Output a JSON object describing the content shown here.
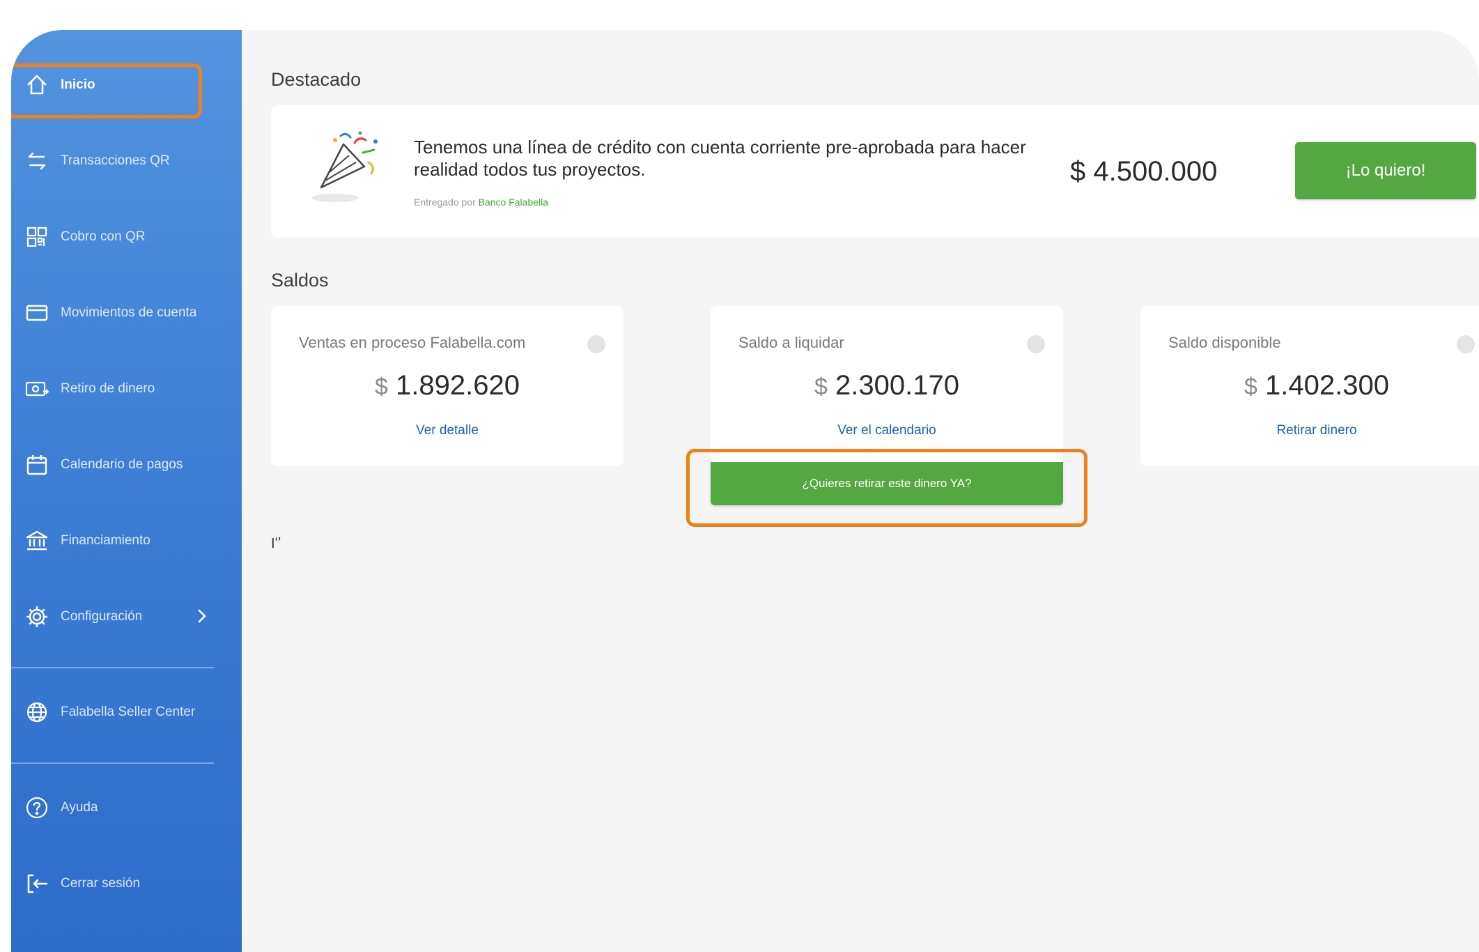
{
  "sidebar": {
    "items": [
      {
        "label": "Inicio",
        "icon": "home-icon"
      },
      {
        "label": "Transacciones QR",
        "icon": "transfer-arrows-icon"
      },
      {
        "label": "Cobro con QR",
        "icon": "qr-code-icon"
      },
      {
        "label": "Movimientos de cuenta",
        "icon": "card-icon"
      },
      {
        "label": "Retiro de dinero",
        "icon": "cash-withdraw-icon"
      },
      {
        "label": "Calendario de pagos",
        "icon": "calendar-icon"
      },
      {
        "label": "Financiamiento",
        "icon": "bank-icon"
      },
      {
        "label": "Configuración",
        "icon": "gear-icon"
      },
      {
        "label": "Falabella Seller Center",
        "icon": "globe-icon"
      },
      {
        "label": "Ayuda",
        "icon": "help-icon"
      },
      {
        "label": "Cerrar sesión",
        "icon": "logout-icon"
      }
    ],
    "active": "Inicio"
  },
  "featured": {
    "section_title": "Destacado",
    "text": "Tenemos una línea de crédito con cuenta corriente pre-aprobada para hacer realidad todos tus proyectos.",
    "source_prefix": "Entregado por",
    "source_bank": "Banco Falabella",
    "amount": "$ 4.500.000",
    "button": "¡Lo quiero!"
  },
  "balances": {
    "section_title": "Saldos",
    "cards": [
      {
        "label": "Ventas en proceso Falabella.com",
        "currency": "$",
        "amount": "1.892.620",
        "link": "Ver detalle"
      },
      {
        "label": "Saldo a liquidar",
        "currency": "$",
        "amount": "2.300.170",
        "link": "Ver el calendario"
      },
      {
        "label": "Saldo disponible",
        "currency": "$",
        "amount": "1.402.300",
        "link": "Retirar dinero"
      }
    ],
    "withdraw_button": "¿Quieres retirar este dinero YA?"
  },
  "stray_mark": "Iʻʼ",
  "colors": {
    "sidebar_top": "#5393df",
    "sidebar_bottom": "#2d6ccb",
    "green_button": "#55a741",
    "highlight": "#f07f16",
    "link": "#1f5fb8"
  }
}
